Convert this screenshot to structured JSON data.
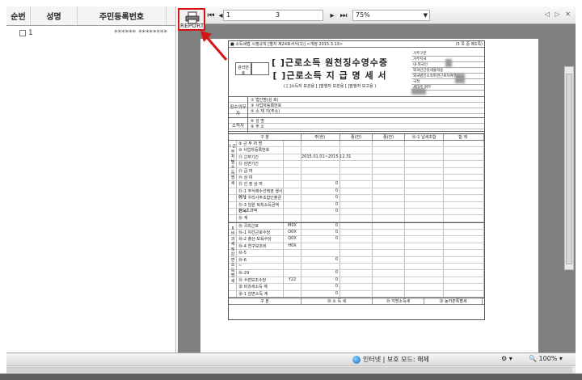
{
  "list": {
    "headers": [
      "순번",
      "성명",
      "주민등록번호"
    ],
    "rows": [
      {
        "no": "1",
        "name": "",
        "rrn": "****** ********"
      }
    ]
  },
  "toolbar": {
    "print_label": "REPORT",
    "current_page": "1",
    "total_pages": "3",
    "zoom": "75%",
    "dropdown_glyph": "▼",
    "right_icons": "◁ ▷ ✕"
  },
  "form": {
    "header_left": "■ 소득세법 시행규칙 [별지 제24호서식(1)] <개정 2015.3.13>",
    "header_right": "(3 쪽 중 제1쪽)",
    "title_line1": "[ ]근로소득 원천징수영수증",
    "title_line2": "[ ]근로소득 지 급 명 세 서",
    "title_line3": "( [ ]소득자 보관용  [ ]발행자 보관용  [ ]발행자 보고용 )",
    "id_label": "관리번호",
    "right_grid": [
      "거주구분",
      "거주지국",
      "내·외국인",
      "외국인단일세율적용",
      "외국법인소속파견근로자여부",
      "국적",
      "세대주 여부",
      "연말정산 구분"
    ],
    "payer_label": "징수의무자",
    "payer_rows": [
      "① 법인명(상 호)",
      "③ 사업자등록번호",
      "⑤ 소 재 지(주소)"
    ],
    "income_label": "소득자",
    "income_rows": [
      "⑥ 성   명",
      "⑧ 주   소"
    ],
    "table_headers": [
      "구   분",
      "주(현)",
      "종(전)",
      "종(전)",
      "⑯-1 납세조합",
      "합   계"
    ],
    "section1_mark": "Ⅰ 근무처별소득명세",
    "section2_mark": "Ⅱ 비과세및감면소득명세",
    "rows1": [
      {
        "label": "⑨ 근 무 처 명",
        "code": "",
        "val": ""
      },
      {
        "label": "⑩ 사업자등록번호",
        "code": "",
        "val": ""
      },
      {
        "label": "⑪ 근무기간",
        "code": "",
        "val": "2015.01.01~2015.12.31"
      },
      {
        "label": "⑫ 감면기간",
        "code": "",
        "val": ""
      },
      {
        "label": "⑬ 급   여",
        "code": "",
        "val": ""
      },
      {
        "label": "⑭ 상   여",
        "code": "",
        "val": ""
      },
      {
        "label": "⑮ 인 정 상 여",
        "code": "",
        "val": "0"
      },
      {
        "label": "⑮-1 주식매수선택권 행사이익",
        "code": "",
        "val": "0"
      },
      {
        "label": "⑮-2 우리사주조합인출금",
        "code": "",
        "val": "0"
      },
      {
        "label": "⑮-3 임원 퇴직소득금액 한도초과액",
        "code": "",
        "val": "0"
      },
      {
        "label": "⑮-4",
        "code": "",
        "val": "0"
      },
      {
        "label": "⑯ 계",
        "code": "",
        "val": ""
      }
    ],
    "rows2": [
      {
        "label": "⑱ 국외근로",
        "code": "M0X",
        "val": "0"
      },
      {
        "label": "⑱-1 야간근로수당",
        "code": "O0X",
        "val": "0"
      },
      {
        "label": "⑱-2 출산·보육수당",
        "code": "Q0X",
        "val": "0"
      },
      {
        "label": "⑱-4 연구보조비",
        "code": "H0X",
        "val": ""
      },
      {
        "label": "⑱-5",
        "code": "",
        "val": ""
      },
      {
        "label": "⑱-6",
        "code": "",
        "val": "0"
      },
      {
        "label": "~",
        "code": "",
        "val": ""
      },
      {
        "label": "⑱-29",
        "code": "",
        "val": "0"
      },
      {
        "label": "⑲ 수련보조수당",
        "code": "Y22",
        "val": "0"
      },
      {
        "label": "⑳ 비과세소득 계",
        "code": "",
        "val": "0"
      },
      {
        "label": "⑳-1 감면소득 계",
        "code": "",
        "val": "0"
      }
    ],
    "footer_row": [
      "구   분",
      "⑱ 소 득 세",
      "⑲ 지방소득세",
      "⑳ 농어촌특별세"
    ]
  },
  "status": {
    "zone_text": "인터넷 | 보호 모드: 해제",
    "zoom_text": "100%"
  },
  "colors": {
    "highlight": "#d41414"
  }
}
